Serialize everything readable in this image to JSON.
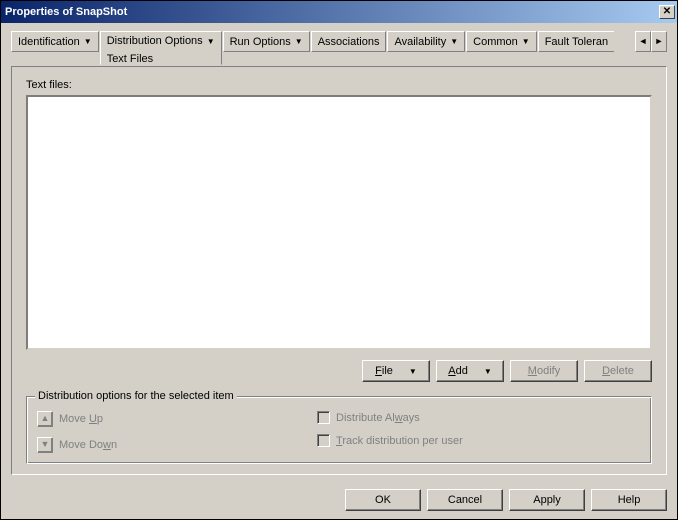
{
  "window": {
    "title": "Properties of SnapShot"
  },
  "tabs": {
    "identification": "Identification",
    "distribution": {
      "label": "Distribution Options",
      "sub": "Text Files"
    },
    "run": "Run Options",
    "associations": "Associations",
    "availability": "Availability",
    "common": "Common",
    "fault": "Fault Toleran"
  },
  "panel": {
    "text_files_label": "Text files:"
  },
  "buttons": {
    "file": "File",
    "add": "Add",
    "modify": "Modify",
    "delete": "Delete"
  },
  "group": {
    "legend": "Distribution options for the selected item",
    "move_up": "Move Up",
    "move_down": "Move Down",
    "dist_always": "Distribute Always",
    "track": "Track distribution per user"
  },
  "footer": {
    "ok": "OK",
    "cancel": "Cancel",
    "apply": "Apply",
    "help": "Help"
  }
}
